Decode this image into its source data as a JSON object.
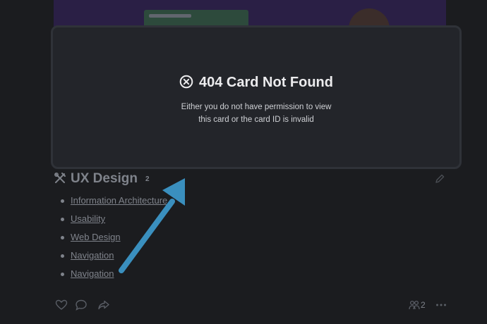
{
  "modal": {
    "title": "404 Card Not Found",
    "message_line1": "Either you do not have permission to view",
    "message_line2": "this card or the card ID is invalid"
  },
  "card": {
    "title": "UX Design",
    "count": "2",
    "items": [
      "Information Architecture",
      "Usability",
      "Web Design",
      "Navigation",
      "Navigation"
    ]
  },
  "footer": {
    "share_count": "2"
  },
  "colors": {
    "accent_arrow": "#3a8fbe",
    "modal_bg": "#23252a",
    "page_bg": "#1b1c1f",
    "muted_text": "#7f838b"
  },
  "icons": {
    "modal": "x-circle-icon",
    "card": "design-tools-icon",
    "edit": "pencil-icon",
    "like": "heart-icon",
    "comment": "comment-icon",
    "share": "share-icon",
    "followers": "people-icon",
    "more": "more-icon"
  }
}
